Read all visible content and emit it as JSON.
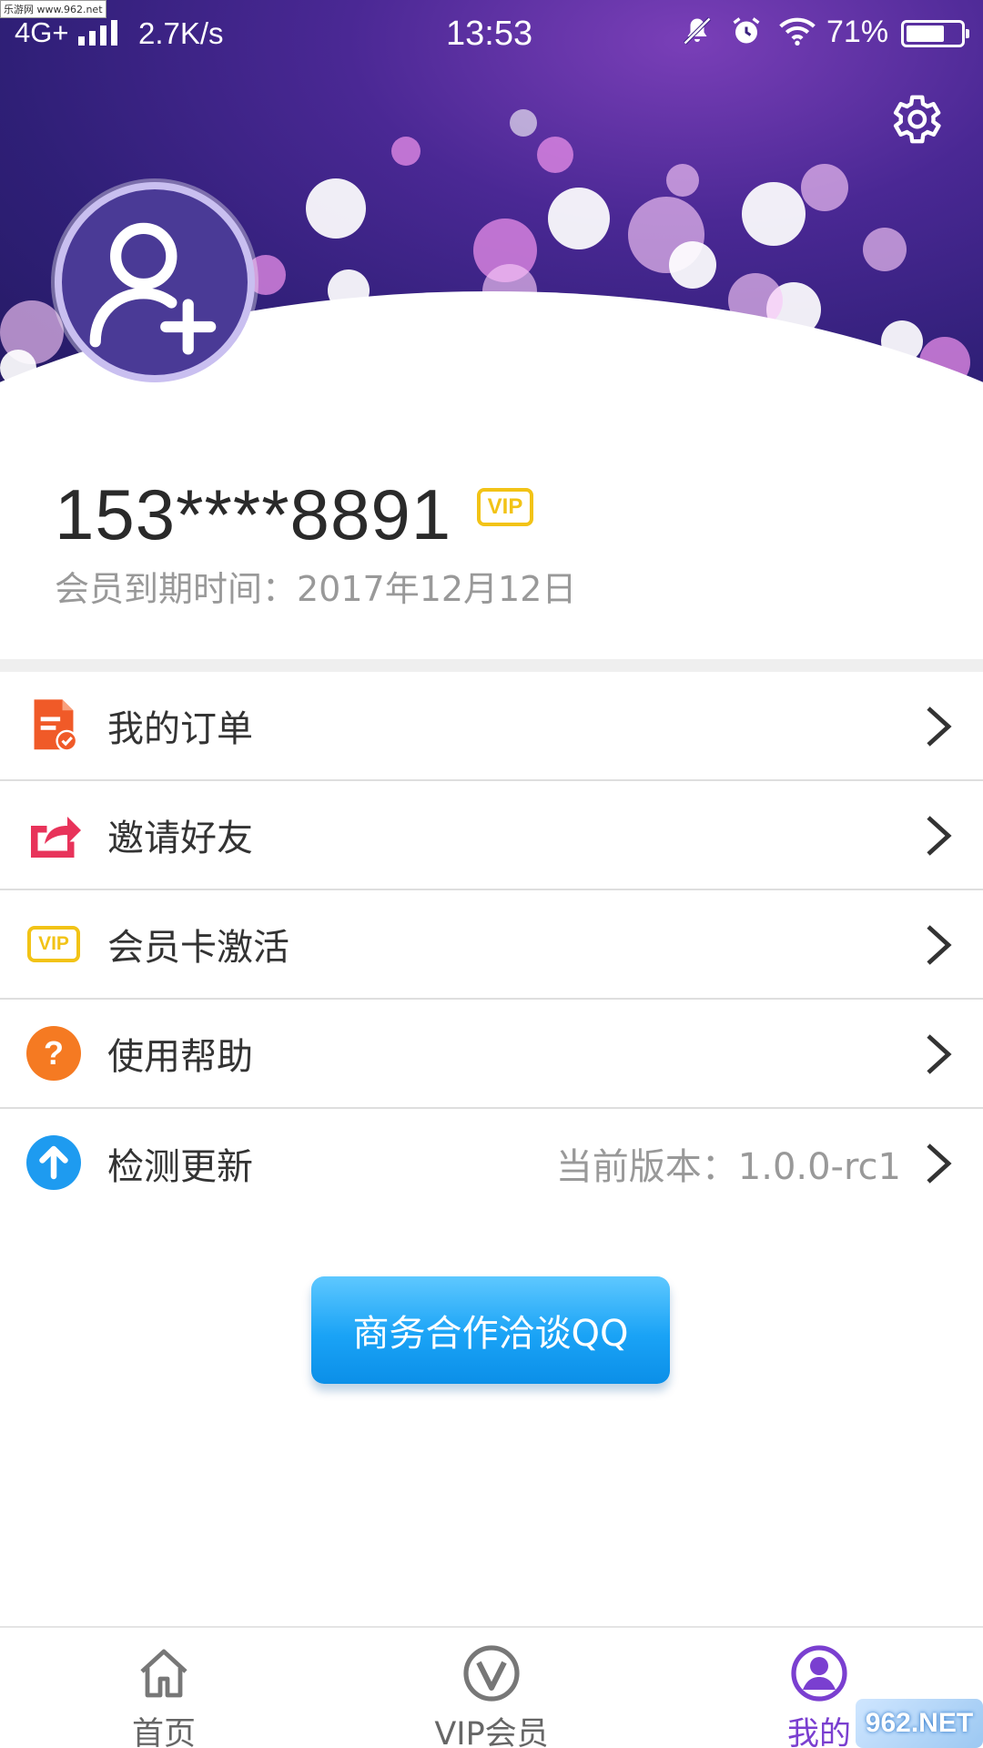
{
  "status_bar": {
    "network": "4G+",
    "speed": "2.7K/s",
    "time": "13:53",
    "battery": "71%",
    "battery_level": 0.71
  },
  "watermark_top": "乐游网 www.962.net",
  "profile": {
    "phone": "153****8891",
    "vip_badge": "VIP",
    "expire_text": "会员到期时间：2017年12月12日"
  },
  "menu": {
    "items": [
      {
        "label": "我的订单",
        "icon": "order-icon",
        "right_text": ""
      },
      {
        "label": "邀请好友",
        "icon": "share-icon",
        "right_text": ""
      },
      {
        "label": "会员卡激活",
        "icon": "vip-card-icon",
        "icon_text": "VIP",
        "right_text": ""
      },
      {
        "label": "使用帮助",
        "icon": "help-icon",
        "icon_text": "?",
        "right_text": ""
      },
      {
        "label": "检测更新",
        "icon": "update-icon",
        "right_text": "当前版本：1.0.0-rc1"
      }
    ]
  },
  "cta": {
    "label": "商务合作洽谈QQ"
  },
  "bottom_nav": {
    "tabs": [
      {
        "label": "首页",
        "icon": "home-icon",
        "active": false
      },
      {
        "label": "VIP会员",
        "icon": "vip-v-icon",
        "active": false
      },
      {
        "label": "我的",
        "icon": "profile-icon",
        "active": true
      }
    ]
  },
  "watermark_bottom": "962.NET",
  "colors": {
    "accent": "#7a3fd0",
    "vip": "#f2c316",
    "cta": "#1aa3f6",
    "order_icon": "#f05a28",
    "share_icon": "#e8335a",
    "help_icon": "#f57a22",
    "update_icon": "#1e9bf0"
  }
}
